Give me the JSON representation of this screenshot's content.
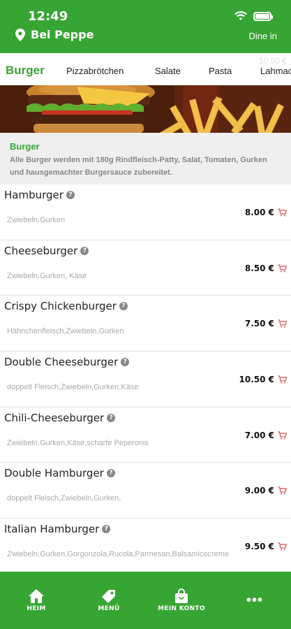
{
  "status": {
    "time": "12:49"
  },
  "header": {
    "restaurant": "Bei Peppe",
    "mode": "Dine in"
  },
  "tabs": [
    {
      "label": "Burger",
      "active": true
    },
    {
      "label": "Pizzabrötchen"
    },
    {
      "label": "Salate"
    },
    {
      "label": "Pasta"
    },
    {
      "label": "Lahmac"
    }
  ],
  "ghost_price": "10.50 €",
  "category": {
    "title": "Burger",
    "description": "Alle Burger werden mit 180g Rindfleisch-Patty, Salat, Tomaten, Gurken und hausgemachter Burgersauce zubereitet."
  },
  "items": [
    {
      "name": "Hamburger",
      "desc": "Zwiebeln,Gurken",
      "price": "8.00 €"
    },
    {
      "name": "Cheeseburger",
      "desc": "Zwiebeln,Gurken, Käse",
      "price": "8.50 €"
    },
    {
      "name": "Crispy Chickenburger",
      "desc": "Hähnchenfleisch,Zwiebeln,Gurken",
      "price": "7.50 €"
    },
    {
      "name": "Double Cheeseburger",
      "desc": "doppelt Fleisch,Zwiebeln,Gurken,Käse",
      "price": "10.50 €"
    },
    {
      "name": "Chili-Cheeseburger",
      "desc": "Zwiebeln,Gurken,Käse,scharfe Peperonis",
      "price": "7.00 €"
    },
    {
      "name": "Double Hamburger",
      "desc": "doppelt Fleisch,Zwiebeln,Gurken,",
      "price": "9.00 €"
    },
    {
      "name": "Italian Hamburger",
      "desc": "Zwiebeln,Gurken,Gorgonzola,Rucola,Parmesan,Balsamicocreme",
      "price": "9.50 €"
    }
  ],
  "nav": [
    {
      "label": "HEIM",
      "icon": "home-icon"
    },
    {
      "label": "MENÜ",
      "icon": "tag-icon"
    },
    {
      "label": "MEIN KONTO",
      "icon": "bag-icon"
    },
    {
      "label": "",
      "icon": "more-icon"
    }
  ],
  "colors": {
    "brand": "#37a534",
    "cart": "#e05050"
  }
}
